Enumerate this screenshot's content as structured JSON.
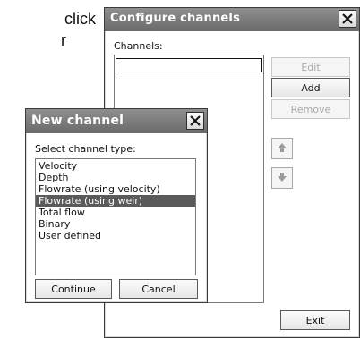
{
  "doc": {
    "line1": "click",
    "line2": "r"
  },
  "configure_window": {
    "title": "Configure channels",
    "channels_label": "Channels:",
    "channel_input_value": "",
    "buttons": {
      "edit": "Edit",
      "add": "Add",
      "remove": "Remove",
      "exit": "Exit"
    },
    "move_up_icon": "arrow-up",
    "move_down_icon": "arrow-down"
  },
  "new_channel_dialog": {
    "title": "New channel",
    "select_label": "Select channel type:",
    "types": [
      "Velocity",
      "Depth",
      "Flowrate (using velocity)",
      "Flowrate (using weir)",
      "Total flow",
      "Binary",
      "User defined"
    ],
    "selected_index": 3,
    "continue_label": "Continue",
    "cancel_label": "Cancel"
  },
  "colors": {
    "titlebar": "#7a7a7a",
    "selected": "#5a5a5a"
  }
}
